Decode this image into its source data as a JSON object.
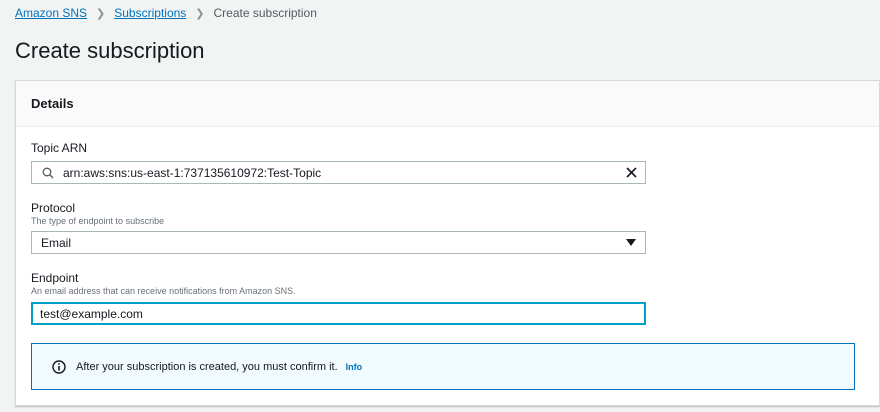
{
  "breadcrumb": {
    "items": [
      "Amazon SNS",
      "Subscriptions"
    ],
    "current": "Create subscription"
  },
  "page": {
    "title": "Create subscription"
  },
  "details": {
    "heading": "Details",
    "topic_arn": {
      "label": "Topic ARN",
      "value": "arn:aws:sns:us-east-1:737135610972:Test-Topic"
    },
    "protocol": {
      "label": "Protocol",
      "description": "The type of endpoint to subscribe",
      "value": "Email"
    },
    "endpoint": {
      "label": "Endpoint",
      "description": "An email address that can receive notifications from Amazon SNS.",
      "value": "test@example.com"
    },
    "alert": {
      "message": "After your subscription is created, you must confirm it.",
      "link": "Info"
    }
  },
  "icons": {
    "search": "search-icon",
    "clear": "close-icon",
    "caret": "caret-down-icon",
    "info": "info-icon"
  },
  "colors": {
    "link": "#0073bb",
    "focus": "#00a1c9",
    "alert_bg": "#f1faff"
  }
}
